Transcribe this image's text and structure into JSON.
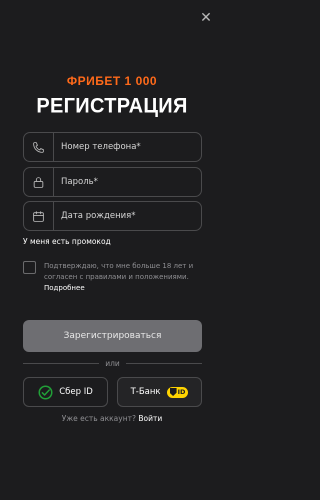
{
  "brand": {
    "logo_text": "ФРИБЕТ 1 000",
    "accent_color": "#ff6a1a"
  },
  "title": "РЕГИСТРАЦИЯ",
  "form": {
    "phone": {
      "placeholder": "Номер телефона*",
      "value": "",
      "icon": "phone-icon"
    },
    "password": {
      "placeholder": "Пароль*",
      "value": "",
      "icon": "lock-icon"
    },
    "birthdate": {
      "placeholder": "Дата рождения*",
      "value": "",
      "icon": "calendar-icon"
    },
    "promo_label": "У меня есть промокод",
    "consent_text": "Подтверждаю, что мне больше 18 лет и согласен с правилами и положениями.",
    "consent_more": "Подробнее",
    "consent_checked": false,
    "submit_label": "Зарегистрироваться"
  },
  "divider": {
    "text": "или"
  },
  "social": {
    "sber_label": "Сбер ID",
    "tbank_label": "Т-Банк",
    "tbank_badge": "ID"
  },
  "footer": {
    "question": "Уже есть аккаунт?",
    "login_link": "Войти"
  },
  "colors": {
    "background": "#1c1c1e",
    "button_disabled": "#6e6e72",
    "border": "#4a4a4c",
    "tbank_yellow": "#ffd400",
    "sber_green": "#21a038"
  }
}
